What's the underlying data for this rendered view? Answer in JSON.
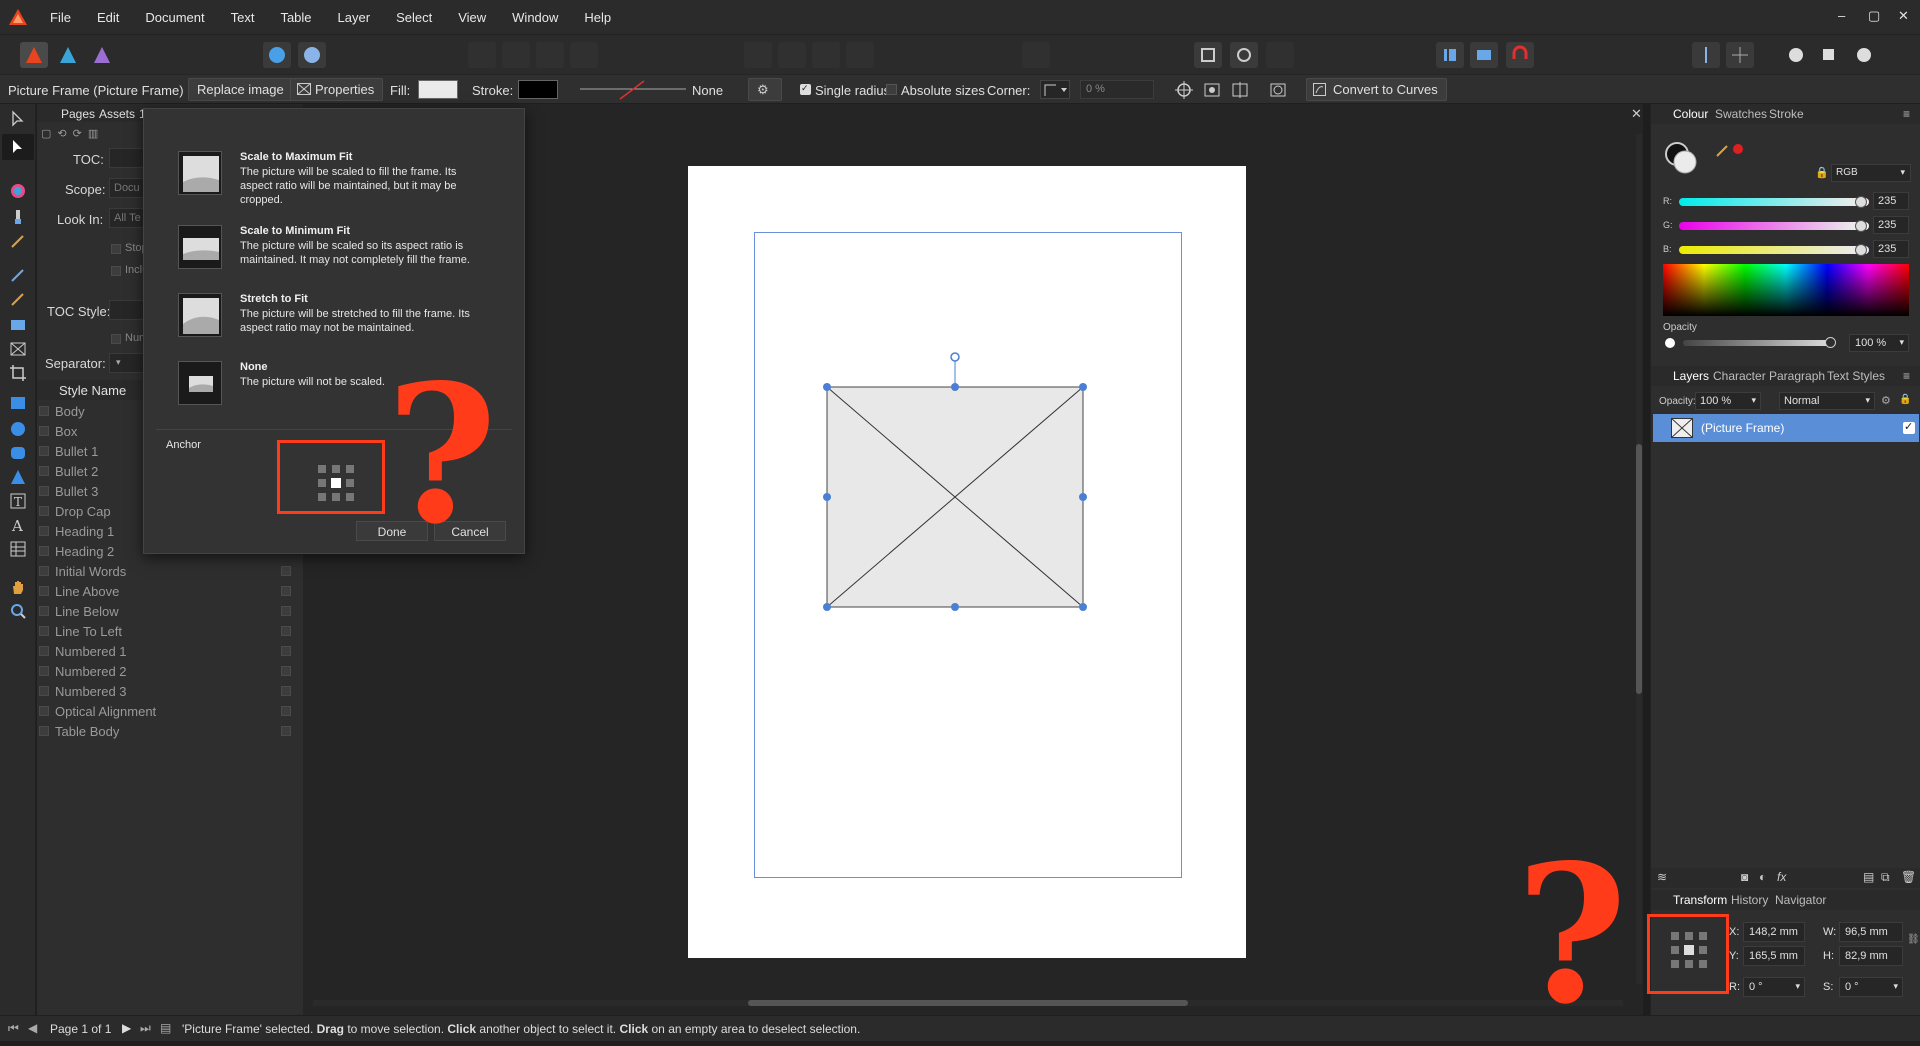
{
  "menu": {
    "items": [
      "File",
      "Edit",
      "Document",
      "Text",
      "Table",
      "Layer",
      "Select",
      "View",
      "Window",
      "Help"
    ],
    "window_controls": [
      "–",
      "▢",
      "✕"
    ]
  },
  "context_bar": {
    "selection_label": "Picture Frame  (Picture Frame)",
    "replace_image": "Replace image",
    "properties": "Properties",
    "fill_label": "Fill:",
    "stroke_label": "Stroke:",
    "stroke_none": "None",
    "single_radius": "Single radius",
    "absolute_sizes": "Absolute sizes",
    "corner_label": "Corner:",
    "corner_value": "0 %",
    "convert_to_curves": "Convert to Curves"
  },
  "left_panel": {
    "tabs": [
      "Pages",
      "Assets",
      "1"
    ],
    "toc_label": "TOC:",
    "scope_label": "Scope:",
    "scope_value": "Docu",
    "look_in_label": "Look In:",
    "look_in_value": "All Te",
    "stop_label": "Stop",
    "include_label": "Inclu",
    "toc_style_label": "TOC Style:",
    "num_label": "Num",
    "separator_label": "Separator:",
    "style_name_header": "Style Name",
    "styles": [
      "Body",
      "Box",
      "Bullet 1",
      "Bullet 2",
      "Bullet 3",
      "Drop Cap",
      "Heading 1",
      "Heading 2",
      "Initial Words",
      "Line Above",
      "Line Below",
      "Line To Left",
      "Numbered 1",
      "Numbered 2",
      "Numbered 3",
      "Optical Alignment",
      "Table Body"
    ]
  },
  "popover": {
    "options": [
      {
        "title": "Scale to Maximum Fit",
        "desc": "The picture will be scaled to fill the frame. Its aspect ratio will be maintained, but it may be cropped."
      },
      {
        "title": "Scale to Minimum Fit",
        "desc": "The picture will be scaled so its aspect ratio is maintained. It may not completely fill the frame."
      },
      {
        "title": "Stretch to Fit",
        "desc": "The picture will be stretched to fill the frame. Its aspect ratio may not be maintained."
      },
      {
        "title": "None",
        "desc": "The picture will not be scaled."
      }
    ],
    "anchor_label": "Anchor",
    "done": "Done",
    "cancel": "Cancel"
  },
  "annotations": {
    "question_mark": "?",
    "accent_color": "#ff3b1a"
  },
  "colour_panel": {
    "tabs": [
      "Colour",
      "Swatches",
      "Stroke"
    ],
    "model": "RGB",
    "r_label": "R:",
    "g_label": "G:",
    "b_label": "B:",
    "r": "235",
    "g": "235",
    "b": "235",
    "opacity_label": "Opacity",
    "opacity": "100 %"
  },
  "layers_panel": {
    "tabs": [
      "Layers",
      "Character",
      "Paragraph",
      "Text Styles"
    ],
    "opacity_label": "Opacity:",
    "opacity_value": "100 %",
    "blend_mode": "Normal",
    "layer_name": "(Picture Frame)",
    "fx_label": "fx"
  },
  "transform_panel": {
    "tabs": [
      "Transform",
      "History",
      "Navigator"
    ],
    "x_label": "X:",
    "x": "148,2 mm",
    "y_label": "Y:",
    "y": "165,5 mm",
    "w_label": "W:",
    "w": "96,5 mm",
    "h_label": "H:",
    "h": "82,9 mm",
    "r_label": "R:",
    "r": "0 °",
    "s_label": "S:",
    "s": "0 °"
  },
  "status_bar": {
    "page": "Page 1 of 1",
    "message_parts": [
      "'Picture Frame' selected. ",
      "Drag",
      " to move selection. ",
      "Click",
      " another object to select it. ",
      "Click",
      " on an empty area to deselect selection."
    ]
  }
}
